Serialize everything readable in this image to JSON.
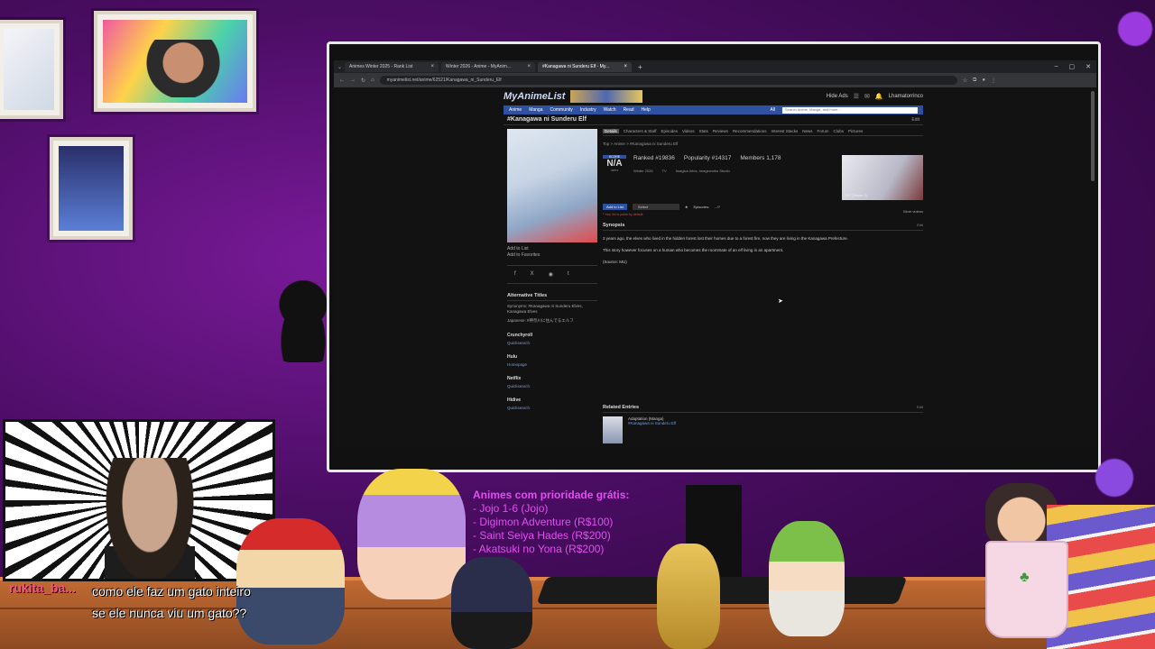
{
  "browser": {
    "tabs": [
      {
        "label": "Animes Winter 2025 - Rank List",
        "active": false
      },
      {
        "label": "Winter 2026 - Anime - MyAnim...",
        "active": false
      },
      {
        "label": "#Kanagawa ni Sunderu Elf - My...",
        "active": true
      }
    ],
    "url": "myanimelist.net/anime/62521/Kanagawa_ni_Sunderu_Elf"
  },
  "mal": {
    "logo": "MyAnimeList",
    "hide_ads": "Hide Ads",
    "username": "Lhamatorrinco",
    "nav": [
      "Anime",
      "Manga",
      "Community",
      "Industry",
      "Watch",
      "Read",
      "Help"
    ],
    "search_placeholder": "Search Anime, Manga, and more...",
    "search_scope": "All",
    "title": "#Kanagawa ni Sunderu Elf",
    "edit": "Edit",
    "page_tabs": [
      "Details",
      "Characters & Staff",
      "Episodes",
      "Videos",
      "Stats",
      "Reviews",
      "Recommendations",
      "Interest Stacks",
      "News",
      "Forum",
      "Clubs",
      "Pictures"
    ],
    "breadcrumb": "Top  >  Anime  >  #Kanagawa ni Sunderu Elf",
    "score_label": "SCORE",
    "score": "N/A",
    "score_users": "users",
    "ranked": "Ranked #19836",
    "popularity": "Popularity #14317",
    "members": "Members 1,178",
    "season": "Winter 2026",
    "type": "TV",
    "studios": "Imagica Infos, Imageworks Studio",
    "add_to_list": "Add to List",
    "select": "Select",
    "episodes": "Episodes:",
    "episodes_value": "- /?",
    "public_note": "* Your list is public by default.",
    "trailer_label": "PV (Teaser 2)",
    "more_videos": "More videos",
    "synopsis_header": "Synopsis",
    "synopsis_p1": "3 years ago, the elves who lived in the hidden forest lost their homes due to a forest fire, now they are living in the Kanagawa Prefecture.",
    "synopsis_p2": "This story however focuses on a human who becomes the roommate of an elf living in an apartment.",
    "synopsis_source": "(Source: MU)",
    "add_list_link": "Add to List",
    "add_favorites_link": "Add to Favorites",
    "alt_titles_header": "Alternative Titles",
    "synonyms": "Synonyms: #Kanagawa ni Sunderu Elves, Kanagawa Elves",
    "japanese": "Japanese: #神奈川に住んでるエルフ",
    "streaming": [
      {
        "name": "Crunchyroll",
        "link": "Quicksearch"
      },
      {
        "name": "Hulu",
        "link": "Homepage"
      },
      {
        "name": "Netflix",
        "link": "Quicksearch"
      },
      {
        "name": "Hidive",
        "link": "Quicksearch"
      }
    ],
    "related_header": "Related Entries",
    "related_type": "Adaptation (Manga)",
    "related_title": "#Kanagawa ni Sunderu Elf"
  },
  "chat": {
    "user": "rukita_ba...",
    "message": "como ele faz um gato inteiro se ele nunca viu um gato??"
  },
  "priority": {
    "header": "Animes com prioridade grátis:",
    "items": [
      "- Jojo 1-6 (Jojo)",
      "- Digimon Adventure (R$100)",
      "- Saint Seiya Hades (R$200)",
      "- Akatsuki no Yona (R$200)"
    ]
  }
}
